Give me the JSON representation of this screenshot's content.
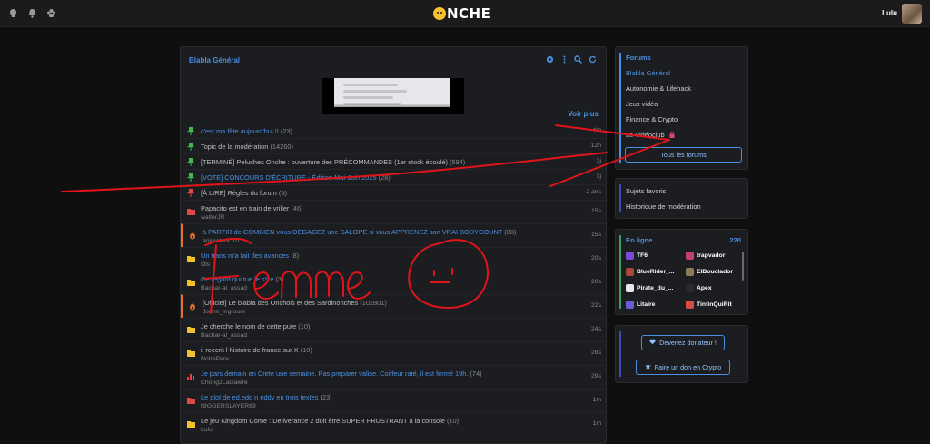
{
  "header": {
    "logo_text": "NCHE",
    "username": "Lulu",
    "icons": [
      "lightbulb-icon",
      "bell-icon",
      "users-icon"
    ]
  },
  "board": {
    "title": "Blabla Général",
    "voir_plus": "Voir plus",
    "icons": [
      "gear-icon",
      "more-icon",
      "search-icon",
      "refresh-icon"
    ]
  },
  "topics": [
    {
      "icon": "pin-green",
      "title": "c'est ma fête aujourd'hui !!",
      "count": "(23)",
      "author": "",
      "time": "4m",
      "link": true,
      "hot": false
    },
    {
      "icon": "pin-green",
      "title": "Topic de la modération",
      "count": "(14260)",
      "author": "",
      "time": "12h",
      "link": false,
      "hot": false
    },
    {
      "icon": "pin-green",
      "title": "[TERMINÉ] Peluches Onche : ouverture des PRÉCOMMANDES (1er stock écoulé)",
      "count": "(594)",
      "author": "",
      "time": "3j",
      "link": false,
      "hot": false
    },
    {
      "icon": "pin-green",
      "title": "[VOTE] CONCOURS D'ÉCRITURE - Édition Mai-Juin 2025",
      "count": "(28)",
      "author": "",
      "time": "3j",
      "link": true,
      "hot": false
    },
    {
      "icon": "pin-red",
      "title": "[À LIRE] Règles du forum",
      "count": "(5)",
      "author": "",
      "time": "2 ans",
      "link": false,
      "hot": false
    },
    {
      "icon": "folder-red",
      "title": "Papacito est en train de vriller",
      "count": "(46)",
      "author": "walterJR",
      "time": "15s",
      "link": false,
      "hot": false
    },
    {
      "icon": "fire",
      "title": "à PARTIR de COMBIEN vous DEGAGEZ une SALOPE si vous APPRENEZ son VRAI BODYCOUNT",
      "count": "(88)",
      "author": "animateur101",
      "time": "15s",
      "link": true,
      "hot": true
    },
    {
      "icon": "folder-yellow",
      "title": "Un trans m'a fait des avances",
      "count": "(8)",
      "author": "Ols",
      "time": "20s",
      "link": true,
      "hot": false
    },
    {
      "icon": "folder-yellow",
      "title": "Ce regard qui tue le s**e",
      "count": "(3)",
      "author": "Bachar-al_assad",
      "time": "20s",
      "link": true,
      "hot": false
    },
    {
      "icon": "fire",
      "title": "[Officiel] Le blabla des Onchois et des Sardinonches",
      "count": "(102801)",
      "author": "Jouhn_ingroum",
      "time": "22s",
      "link": false,
      "hot": true
    },
    {
      "icon": "folder-yellow",
      "title": "Je cherche le nom de cette pute",
      "count": "(10)",
      "author": "Bachar-al_assad",
      "time": "24s",
      "link": false,
      "hot": false
    },
    {
      "icon": "folder-yellow",
      "title": "il reecrit l histoire de france sur X",
      "count": "(10)",
      "author": "NotrePere",
      "time": "28s",
      "link": false,
      "hot": false
    },
    {
      "icon": "chart",
      "title": "Je pars demain en Crete une semaine. Pas preparer valise. Coiffeur raté, il est fermé 19h.",
      "count": "(74)",
      "author": "Chong2LaGalere",
      "time": "29s",
      "link": true,
      "hot": false
    },
    {
      "icon": "folder-red",
      "title": "Le plot de ed,edd n eddy en trois textes",
      "count": "(23)",
      "author": "NIGGERSLAYER69",
      "time": "1m",
      "link": true,
      "hot": false
    },
    {
      "icon": "folder-yellow",
      "title": "Le jeu Kingdom Come : Deliverance 2 doit être SUPER FRUSTRANT à la console",
      "count": "(10)",
      "author": "Lulu",
      "time": "1m",
      "link": false,
      "hot": false
    }
  ],
  "forums": {
    "title": "Forums",
    "items": [
      "Blabla Général",
      "Autonomie & Lifehack",
      "Jeux vidéo",
      "Finance & Crypto",
      "Le Vidéoclub"
    ],
    "all_button": "Tous les forums"
  },
  "favorites": {
    "items": [
      "Sujets favoris",
      "Historique de modération"
    ]
  },
  "online": {
    "title": "En ligne",
    "count": "220",
    "users": [
      {
        "name": "TF6",
        "color": "#7a4bd6"
      },
      {
        "name": "trapvador",
        "color": "#c2426a"
      },
      {
        "name": "BlueRider_...",
        "color": "#a84a3a"
      },
      {
        "name": "ElBouclador",
        "color": "#8a7a5a"
      },
      {
        "name": "Pirate_du_...",
        "color": "#e8e8e8"
      },
      {
        "name": "Apex",
        "color": "#2a2a2a"
      },
      {
        "name": "Litaire",
        "color": "#6a5ad6"
      },
      {
        "name": "TintinQuiRit",
        "color": "#d64a4a"
      }
    ]
  },
  "donate": {
    "donor_button": "Devenez donateur !",
    "crypto_button": "Faire un don en Crypto"
  },
  "drawing": {
    "scribble_text": "Femme",
    "color": "#e0141a"
  }
}
